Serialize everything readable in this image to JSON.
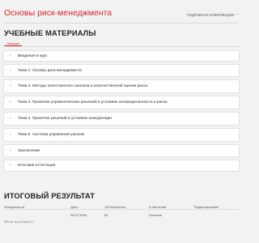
{
  "header": {
    "course_title": "Основы риск-менеджмента",
    "detail_link": "ПОДРОБНАЯ ИНФОРМАЦИЯ",
    "detail_icon": "chevron-right-icon"
  },
  "materials": {
    "heading": "УЧЕБНЫЕ МАТЕРИАЛЫ",
    "tab_current": "Текущие",
    "check_icon": "check-icon",
    "accent_color": "#d7272e",
    "check_color": "#9cc33a",
    "topics": [
      "Введение в курс",
      "Тема 1. Основы риск-менеджмента",
      "Тема 2. Методы качественного анализа и количественной оценки риска",
      "Тема 3. Принятие управленческих решений в условиях неопределенности и риска",
      "Тема 4. Принятие решений в условиях конкуренции",
      "Тема 5. Система управления риском",
      "Заключение",
      "Итоговая аттестация"
    ]
  },
  "result": {
    "heading": "ИТОГОВЫЙ РЕЗУЛЬТАТ",
    "columns": [
      "№ ведомости",
      "Дата",
      "100-балльная",
      "5-балльная",
      "Редактирование"
    ],
    "rows": [
      [
        "",
        "26.07.2024",
        "92",
        "Отлично",
        ""
      ]
    ]
  },
  "footer": {
    "note": "КИУ им. ниу (Открыть) /1"
  }
}
